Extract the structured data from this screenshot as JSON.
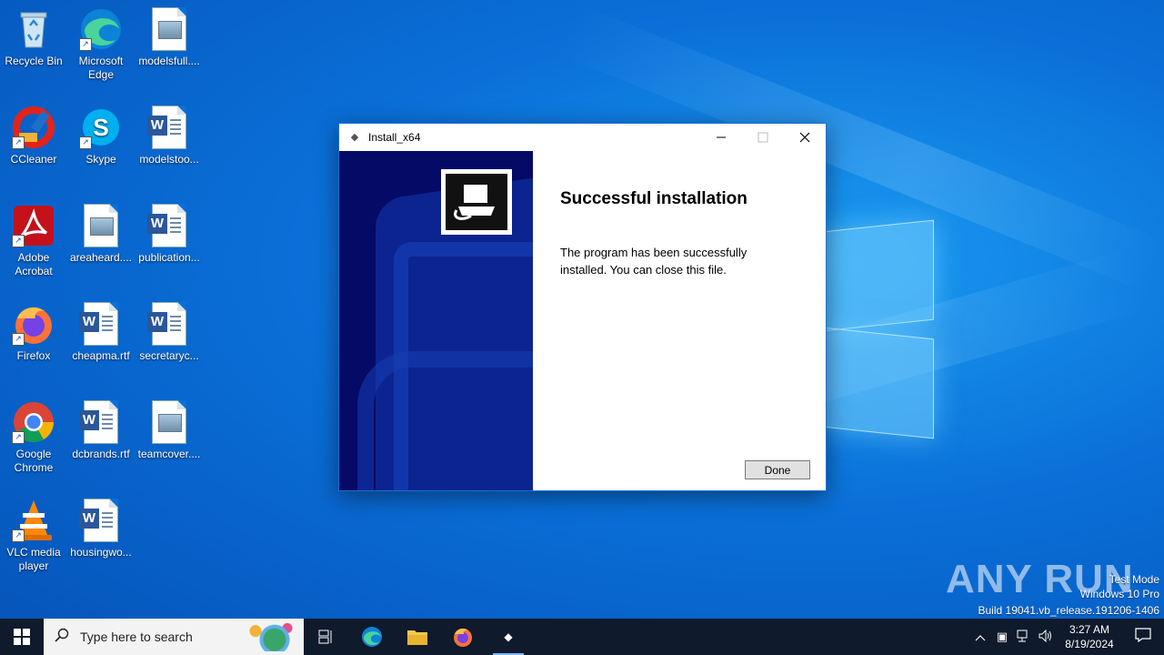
{
  "desktop": {
    "icons": [
      {
        "label": "Recycle Bin",
        "icon": "recycle-bin-icon"
      },
      {
        "label": "Microsoft Edge",
        "icon": "edge-icon"
      },
      {
        "label": "modelsfull....",
        "icon": "image-file-icon"
      },
      {
        "label": "CCleaner",
        "icon": "ccleaner-icon"
      },
      {
        "label": "Skype",
        "icon": "skype-icon"
      },
      {
        "label": "modelstoo...",
        "icon": "word-doc-icon"
      },
      {
        "label": "Adobe Acrobat",
        "icon": "acrobat-icon"
      },
      {
        "label": "areaheard....",
        "icon": "image-file-icon"
      },
      {
        "label": "publication...",
        "icon": "word-doc-icon"
      },
      {
        "label": "Firefox",
        "icon": "firefox-icon"
      },
      {
        "label": "cheapma.rtf",
        "icon": "word-doc-icon"
      },
      {
        "label": "secretaryc...",
        "icon": "word-doc-icon"
      },
      {
        "label": "Google Chrome",
        "icon": "chrome-icon"
      },
      {
        "label": "dcbrands.rtf",
        "icon": "word-doc-icon"
      },
      {
        "label": "teamcover....",
        "icon": "image-file-icon"
      },
      {
        "label": "VLC media player",
        "icon": "vlc-icon"
      },
      {
        "label": "housingwo...",
        "icon": "word-doc-icon"
      }
    ]
  },
  "window": {
    "title": "Install_x64",
    "heading": "Successful installation",
    "message": "The program has been successfully installed. You can close this file.",
    "done_label": "Done"
  },
  "taskbar": {
    "search_placeholder": "Type here to search",
    "time": "3:27 AM",
    "date": "8/19/2024"
  },
  "watermark": {
    "brand": "ANY RUN",
    "mode": "Test Mode",
    "edition": "Windows 10 Pro",
    "build": "Build 19041.vb_release.191206-1406"
  },
  "colors": {
    "accent": "#0a6fd8",
    "sidebar": "#050a66",
    "taskbar": "#0f1a2c"
  }
}
